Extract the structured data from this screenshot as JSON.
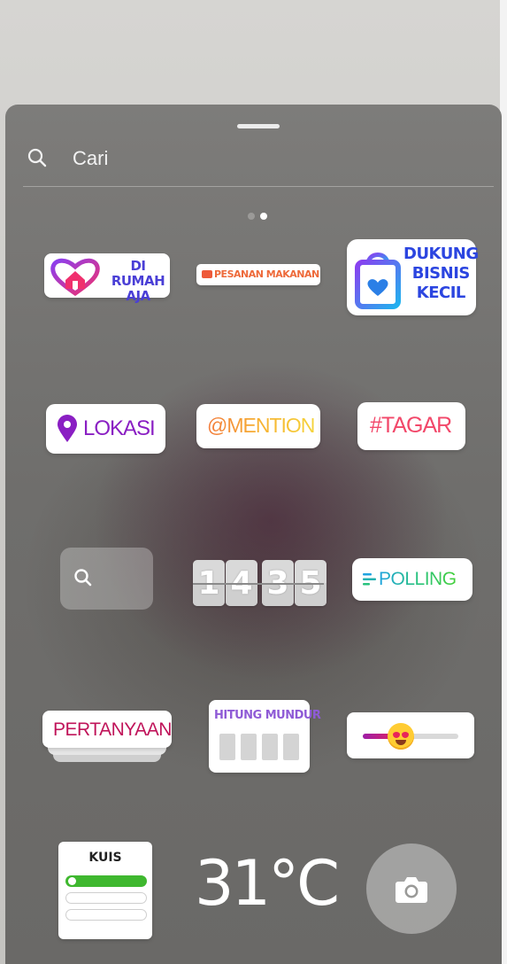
{
  "search": {
    "placeholder": "Cari"
  },
  "pager": {
    "pages": 2,
    "active": 2
  },
  "stickers": {
    "home": {
      "line1": "DI RUMAH",
      "line2": "AJA"
    },
    "food": {
      "label": "PESANAN MAKANAN"
    },
    "small_business": {
      "line1": "DUKUNG",
      "line2": "BISNIS",
      "line3": "KECIL"
    },
    "location": {
      "label": "LOKASI"
    },
    "mention": {
      "label": "@MENTION"
    },
    "hashtag": {
      "label": "#TAGAR"
    },
    "clock": {
      "digits": [
        "1",
        "4",
        "3",
        "5"
      ]
    },
    "poll": {
      "label": "POLLING"
    },
    "questions": {
      "label": "PERTANYAAN"
    },
    "countdown": {
      "label": "HITUNG MUNDUR"
    },
    "emoji_slider": {
      "level": 0.4
    },
    "quiz": {
      "label": "KUIS"
    },
    "temperature": {
      "label": "31°C"
    }
  },
  "colors": {
    "location": "#8a1fc3",
    "hashtag": "#f2486a",
    "questions": "#c0145a",
    "countdown": "#8f5bd6",
    "quiz_correct": "#3fb82f"
  }
}
